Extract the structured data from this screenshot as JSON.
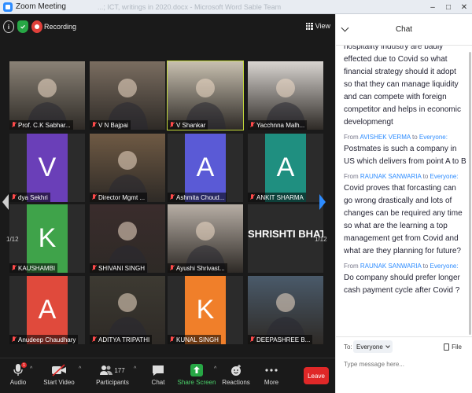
{
  "window": {
    "title": "Zoom Meeting",
    "ghost_title": "...; ICT, writings in 2020.docx - Microsoft Word    Sable Team",
    "minimize": "–",
    "maximize": "□",
    "close": "✕"
  },
  "topbar": {
    "info": "i",
    "recording": "Recording",
    "view": "View"
  },
  "pager": {
    "left": "1/12",
    "right": "1/12"
  },
  "tiles": [
    {
      "name": "Prof. C.K Sabhar...",
      "type": "photo",
      "bg": "#8a8276"
    },
    {
      "name": "V N Bajpai",
      "type": "photo",
      "bg": "#7a6d60"
    },
    {
      "name": "V Shankar",
      "type": "photo",
      "bg": "#c8c0b0"
    },
    {
      "name": "Yacchnna Malh...",
      "type": "photo",
      "bg": "#d8d4d0"
    },
    {
      "name": "dya Sekhri",
      "type": "letter",
      "letter": "V",
      "bg": "#6a3fb8"
    },
    {
      "name": "Director Mgmt ...",
      "type": "photo",
      "bg": "#6f5a44"
    },
    {
      "name": "Ashmita Choud...",
      "type": "letter",
      "letter": "A",
      "bg": "#5a5ad6"
    },
    {
      "name": "ANKIT SHARMA",
      "type": "letter",
      "letter": "A",
      "bg": "#1f8f80"
    },
    {
      "name": "KAUSHAMBI",
      "type": "letter",
      "letter": "K",
      "bg": "#3fa34a"
    },
    {
      "name": "SHIVANI SINGH",
      "type": "photo",
      "bg": "#3a2c2c"
    },
    {
      "name": "Ayushi Shrivast...",
      "type": "photo",
      "bg": "#b7aea5"
    },
    {
      "name": "SHRISHTI BHAT...",
      "type": "bigname"
    },
    {
      "name": "Anudeep Chaudhary",
      "type": "letter",
      "letter": "A",
      "bg": "#e04a3c"
    },
    {
      "name": "ADITYA TRIPATHI",
      "type": "photo",
      "bg": "#3d3a32"
    },
    {
      "name": "KUNAL SINGH",
      "type": "letter",
      "letter": "K",
      "bg": "#f07f2a"
    },
    {
      "name": "DEEPASHREE B...",
      "type": "photo",
      "bg": "#4a5a6a"
    }
  ],
  "chat": {
    "title": "Chat",
    "messages": [
      {
        "from": "",
        "to": "",
        "text": "hospitality industry are badly effected due to Covid so what financial strategy should it adopt so that they can manage liquidity and can compete with foreign competitor and helps in economic developmengt"
      },
      {
        "from": "AVISHEK VERMA",
        "to": "Everyone",
        "text": "Postmates is such a company in US which delivers from point A to B"
      },
      {
        "from": "RAUNAK SANWARIA",
        "to": "Everyone",
        "text": "Covid proves that forcasting can go wrong drastically and lots of changes can be required any time so what are the learning a top management get from Covid and what are they planning for future?"
      },
      {
        "from": "RAUNAK SANWARIA",
        "to": "Everyone",
        "text": "Do company should prefer longer cash payment cycle after Covid ?"
      }
    ],
    "from_prefix": "From",
    "to_word": "to",
    "to_label": "To:",
    "to_value": "Everyone",
    "file_label": "File",
    "input_placeholder": "Type message here..."
  },
  "toolbar": {
    "audio": "Audio",
    "start_video": "Start Video",
    "participants": "Participants",
    "participant_count": "177",
    "chat": "Chat",
    "share_screen": "Share Screen",
    "reactions": "Reactions",
    "more": "More",
    "leave": "Leave",
    "audio_badge": "1"
  },
  "colors": {
    "accent_blue": "#2d8cff",
    "green": "#4bd06a",
    "leave_red": "#e02828",
    "active_border": "#c4d93a"
  }
}
